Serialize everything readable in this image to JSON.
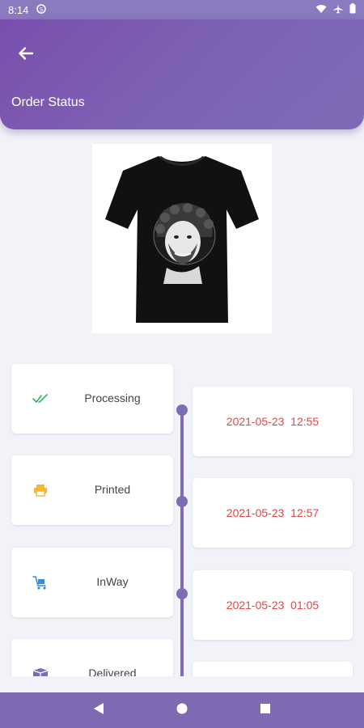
{
  "status_bar": {
    "time": "8:14"
  },
  "appbar": {
    "title": "Order Status"
  },
  "colors": {
    "primary": "#7d62b4",
    "date_text": "#e64545",
    "timeline": "#7e6db4"
  },
  "timeline": [
    {
      "status": "Processing",
      "icon": "double-check-icon",
      "date": "2021-05-23  12:55"
    },
    {
      "status": "Printed",
      "icon": "printer-icon",
      "date": "2021-05-23  12:57"
    },
    {
      "status": "InWay",
      "icon": "delivery-cart-icon",
      "date": "2021-05-23  01:05"
    },
    {
      "status": "Delivered",
      "icon": "package-icon",
      "date": ""
    }
  ]
}
